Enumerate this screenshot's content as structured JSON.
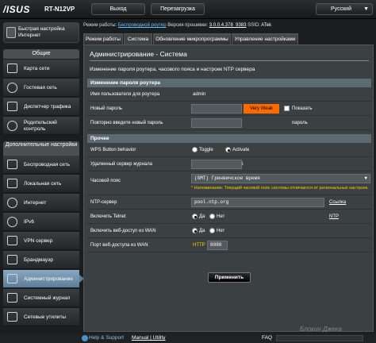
{
  "header": {
    "logo": "/ISUS",
    "model": "RT-N12VP",
    "logout_label": "Выход",
    "reboot_label": "Перезагрузка",
    "language": "Русский"
  },
  "sidebar": {
    "quick_setup": "Быстрая настройка Интернет",
    "general_title": "Общие",
    "general_items": [
      {
        "label": "Карта сети",
        "icon": "network-map-icon"
      },
      {
        "label": "Гостевая сеть",
        "icon": "guest-network-icon"
      },
      {
        "label": "Диспетчер трафика",
        "icon": "traffic-manager-icon"
      },
      {
        "label": "Родительский контроль",
        "icon": "parental-control-icon"
      }
    ],
    "advanced_title": "Дополнительные настройки",
    "advanced_items": [
      {
        "label": "Беспроводная сеть",
        "icon": "wireless-icon"
      },
      {
        "label": "Локальная сеть",
        "icon": "lan-icon"
      },
      {
        "label": "Интернет",
        "icon": "globe-icon"
      },
      {
        "label": "IPv6",
        "icon": "ipv6-icon"
      },
      {
        "label": "VPN сервер",
        "icon": "vpn-icon"
      },
      {
        "label": "Брандмауэр",
        "icon": "firewall-icon"
      },
      {
        "label": "Администрирование",
        "icon": "admin-icon"
      },
      {
        "label": "Системный журнал",
        "icon": "syslog-icon"
      },
      {
        "label": "Сетевые утилиты",
        "icon": "network-tools-icon"
      }
    ]
  },
  "status": {
    "mode_label": "Режим работы:",
    "mode_value": "Беспроводной роутер",
    "fw_label": "Версия прошивки:",
    "fw_value": "3.0.0.4.378_9383",
    "ssid_label": "SSID:",
    "ssid_value": "ATek"
  },
  "tabs": [
    "Режим работы",
    "Система",
    "Обновление микропрограммы",
    "Управление настройками"
  ],
  "panel": {
    "title": "Администрирование - Система",
    "description": "Изменение пароля роутера, часового пояса и настроек NTP сервера",
    "group1_title": "Изменение пароля роутера",
    "username_label": "Имя пользователя для роутера",
    "username_value": "admin",
    "new_password_label": "Новый пароль",
    "strength": "Very Weak",
    "show_password_label": "Показать пароль",
    "repeat_password_label": "Повторно введите новый пароль",
    "group2_title": "Прочее",
    "wps_label": "WPS Button behavior",
    "wps_opt1": "Toggle Radio",
    "wps_opt2": "Activate WPS",
    "remote_log_label": "Удаленный сервер журнала",
    "timezone_label": "Часовой пояс",
    "timezone_value": "(GMT) Гринвичское время",
    "timezone_note": "* Напоминание: Текущий часовой пояс системы отличается от региональных настроек.",
    "ntp_label": "NTP-сервер",
    "ntp_value": "pool.ntp.org",
    "ntp_link": "Ссылка NTP",
    "telnet_label": "Включить Telnet",
    "wan_web_label": "Включить веб-доступ из WAN",
    "wan_port_label": "Порт веб-доступа из WAN",
    "yes": "Да",
    "no": "Нет",
    "http_label": "HTTP",
    "port_value": "8080",
    "apply_label": "Применить"
  },
  "footer": {
    "help": "Help & Support",
    "manual": "Manual",
    "utility": "Utility",
    "faq": "FAQ"
  },
  "watermark": "Блокин Джека",
  "colors": {
    "accent_active": "#8aa7c0",
    "group_header": "#5c6a72",
    "weak_strength": "#ff6a00"
  }
}
